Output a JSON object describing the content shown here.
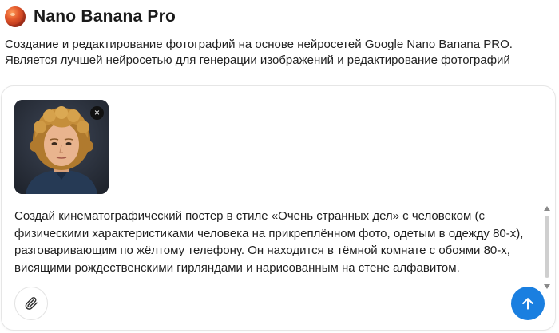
{
  "app": {
    "title": "Nano Banana Pro",
    "description_line1": "Создание и редактирование фотографий на основе нейросетей Google Nano Banana PRO.",
    "description_line2": "Является лучшей нейросетью для генерации изображений и редактирование фотографий"
  },
  "composer": {
    "attachment": {
      "remove_label": "×"
    },
    "prompt": "Создай кинематографический постер в стиле «Очень странных дел» с человеком (с физическими характеристиками человека на прикреплённом фото, одетым в одежду 80-х), разговаривающим по жёлтому телефону. Он находится в тёмной комнате с обоями 80-х, висящими рождественскими гирляндами и нарисованным на стене алфавитом.",
    "attach_icon": "paperclip-icon",
    "send_icon": "arrow-up-icon",
    "accent_color": "#1a7fe0"
  }
}
